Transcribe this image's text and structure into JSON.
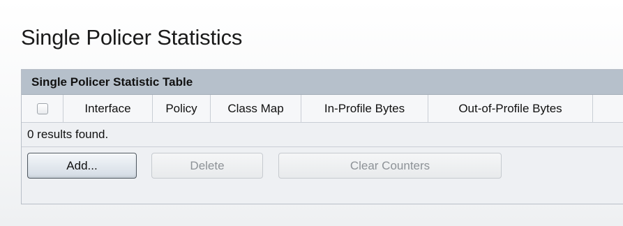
{
  "page": {
    "title": "Single Policer Statistics"
  },
  "table": {
    "caption": "Single Policer Statistic Table",
    "columns": [
      "Interface",
      "Policy",
      "Class Map",
      "In-Profile Bytes",
      "Out-of-Profile Bytes"
    ],
    "results_text": "0 results found."
  },
  "buttons": {
    "add_label": "Add...",
    "delete_label": "Delete",
    "clear_label": "Clear Counters"
  },
  "state": {
    "select_all_checked": false,
    "delete_enabled": false,
    "clear_counters_enabled": false
  }
}
